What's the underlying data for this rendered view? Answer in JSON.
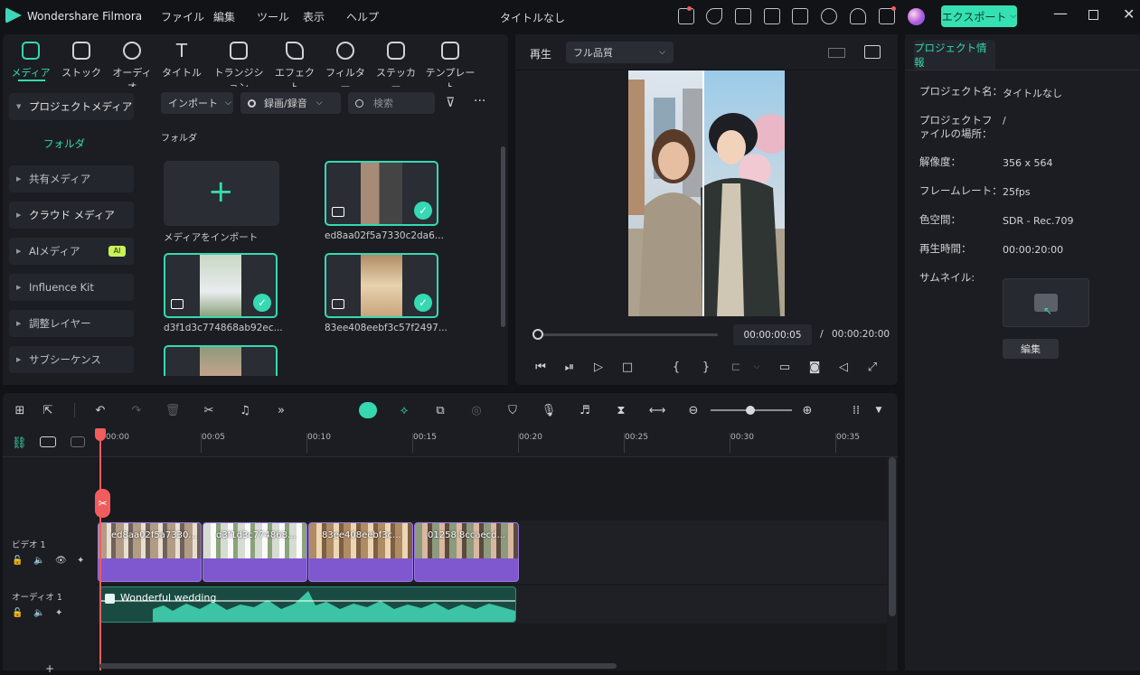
{
  "app": {
    "name": "Wondershare Filmora",
    "doc_title": "タイトルなし",
    "export_label": "エクスポート"
  },
  "menu": [
    "ファイル",
    "編集",
    "ツール",
    "表示",
    "ヘルプ"
  ],
  "categories": [
    {
      "label": "メディア",
      "icon": "media-icon"
    },
    {
      "label": "ストック",
      "icon": "stock-icon"
    },
    {
      "label": "オーディオ",
      "icon": "audio-icon"
    },
    {
      "label": "タイトル",
      "icon": "title-icon"
    },
    {
      "label": "トランジション",
      "icon": "transition-icon"
    },
    {
      "label": "エフェクト",
      "icon": "effect-icon"
    },
    {
      "label": "フィルター",
      "icon": "filter-icon"
    },
    {
      "label": "ステッカー",
      "icon": "sticker-icon"
    },
    {
      "label": "テンプレート",
      "icon": "template-icon"
    }
  ],
  "sidebar": {
    "items": [
      "プロジェクトメディア",
      "共有メディア",
      "クラウド メディア",
      "AIメディア",
      "Influence Kit",
      "調整レイヤー",
      "サブシーケンス"
    ],
    "folder": "フォルダ",
    "ai_badge": "AI"
  },
  "media": {
    "import_dropdown": "インポート",
    "record_dropdown": "録画/録音",
    "search_placeholder": "検索",
    "folder_label": "フォルダ",
    "import_tile_label": "メディアをインポート",
    "files": [
      "ed8aa02f5a7330c2da6...",
      "d3f1d3c774868ab92ec...",
      "83ee408eebf3c57f2497..."
    ]
  },
  "player": {
    "tab": "再生",
    "quality": "フル品質",
    "current_time": "00:00:00:05",
    "separator": "/",
    "total_time": "00:00:20:00",
    "progress_fraction": 0.0
  },
  "project": {
    "tab": "プロジェクト情報",
    "rows": [
      {
        "label": "プロジェクト名：",
        "value": "タイトルなし"
      },
      {
        "label": "プロジェクトファイルの場所：",
        "value": "/"
      },
      {
        "label": "解像度：",
        "value": "356 x 564"
      },
      {
        "label": "フレームレート：",
        "value": "25fps"
      },
      {
        "label": "色空間：",
        "value": "SDR - Rec.709"
      },
      {
        "label": "再生時間：",
        "value": "00:00:20:00"
      }
    ],
    "thumbnail_label": "サムネイル:",
    "edit_button": "編集"
  },
  "timeline": {
    "ticks": [
      "00:00",
      "00:05",
      "00:10",
      "00:15",
      "00:20",
      "00:25",
      "00:30",
      "00:35"
    ],
    "video_track": "ビデオ 1",
    "audio_track": "オーディオ 1",
    "clips": [
      "ed8aa02f5a7330...",
      "d3f1d3c774868...",
      "83ee408eebf3c...",
      "01258 8ccaecd..."
    ],
    "audio_clip": "Wonderful wedding",
    "zoom_fraction": 0.45
  },
  "colors": {
    "accent": "#36d8b0",
    "clip": "#7f58cf",
    "playhead": "#f25c5c",
    "audio": "#2f8a77"
  }
}
